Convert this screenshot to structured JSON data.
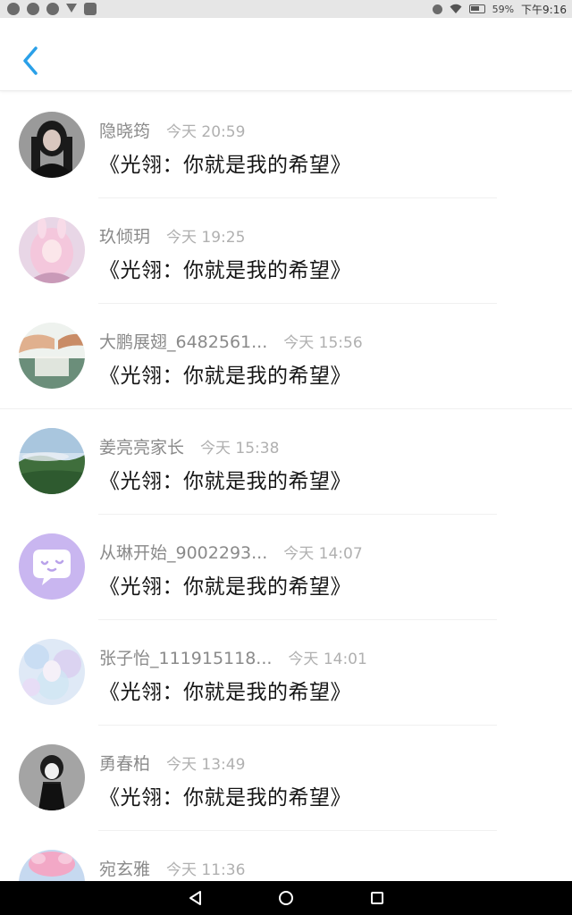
{
  "status_bar": {
    "battery": "59%",
    "time": "下午9:16"
  },
  "header": {
    "back_icon": "chevron-left-icon",
    "accent_color": "#2aa0e8"
  },
  "messages": [
    {
      "name": "隐晓筠",
      "time": "今天 20:59",
      "text": "《光翎：你就是我的希望》"
    },
    {
      "name": "玖倾玥",
      "time": "今天 19:25",
      "text": "《光翎：你就是我的希望》"
    },
    {
      "name": "大鹏展翅_6482561...",
      "time": "今天 15:56",
      "text": "《光翎：你就是我的希望》"
    },
    {
      "name": "姜亮亮家长",
      "time": "今天 15:38",
      "text": "《光翎：你就是我的希望》"
    },
    {
      "name": "从琳开始_9002293...",
      "time": "今天 14:07",
      "text": "《光翎：你就是我的希望》"
    },
    {
      "name": "张子怡_111915118...",
      "time": "今天 14:01",
      "text": "《光翎：你就是我的希望》"
    },
    {
      "name": "勇春柏",
      "time": "今天 13:49",
      "text": "《光翎：你就是我的希望》"
    },
    {
      "name": "宛玄雅",
      "time": "今天 11:36",
      "text": ""
    }
  ],
  "nav_bar": {
    "back_icon": "triangle-back-icon",
    "home_icon": "circle-home-icon",
    "recents_icon": "square-recents-icon"
  }
}
